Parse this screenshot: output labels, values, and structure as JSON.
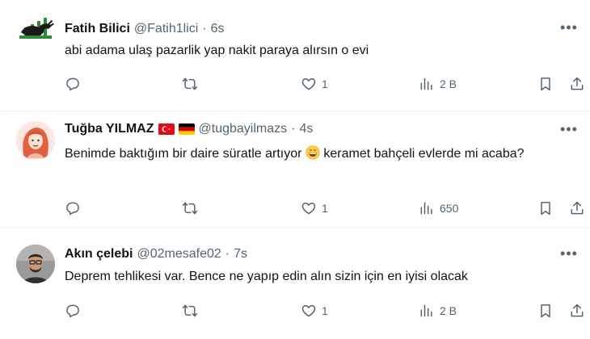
{
  "tweets": [
    {
      "name": "Fatih Bilici",
      "handle": "@Fatih1lici",
      "separator": "·",
      "time": "6s",
      "text": "abi adama ulaş pazarlik yap nakit paraya alırsın o evi",
      "text_after_emoji": "",
      "likes": "1",
      "views": "2 B",
      "has_flags": false,
      "has_emoji": false
    },
    {
      "name": "Tuğba YILMAZ",
      "handle": "@tugbayilmazs",
      "separator": "·",
      "time": "4s",
      "text": "Benimde baktığım bir daire süratle artıyor",
      "text_after_emoji": " keramet bahçeli evlerde mi acaba?",
      "likes": "1",
      "views": "650",
      "has_flags": true,
      "has_emoji": true
    },
    {
      "name": "Akın çelebi",
      "handle": "@02mesafe02",
      "separator": "·",
      "time": "7s",
      "text": "Deprem tehlikesi var. Bence ne yapıp edin alın sizin için en iyisi olacak",
      "text_after_emoji": "",
      "likes": "1",
      "views": "2 B",
      "has_flags": false,
      "has_emoji": false
    }
  ],
  "icons": {
    "reply": "reply-icon",
    "retweet": "retweet-icon",
    "like": "heart-icon",
    "views": "views-icon",
    "bookmark": "bookmark-icon",
    "share": "share-icon",
    "more": "more-icon"
  },
  "colors": {
    "text": "#0f1419",
    "secondary": "#536471",
    "divider": "#eff3f4"
  }
}
